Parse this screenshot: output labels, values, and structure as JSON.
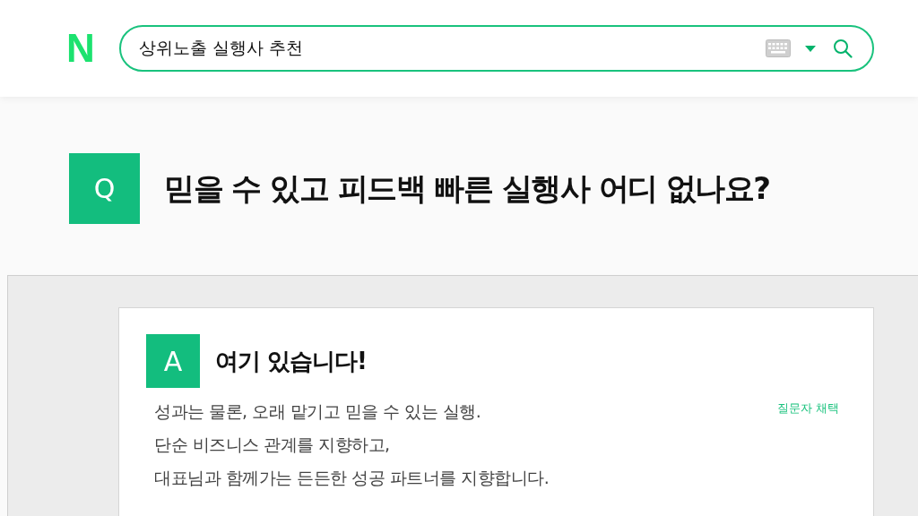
{
  "logo": "N",
  "search": {
    "value": "상위노출 실행사 추천"
  },
  "question": {
    "badge": "Q",
    "title": "믿을 수 있고 피드백 빠른 실행사 어디 없나요?"
  },
  "answer": {
    "badge": "A",
    "title": "여기 있습니다!",
    "tag": "질문자 채택",
    "lines": [
      "성과는 물론, 오래 맡기고 믿을 수 있는 실행.",
      "단순 비즈니스 관계를 지향하고,",
      "대표님과 함께가는 든든한 성공 파트너를 지향합니다."
    ]
  }
}
